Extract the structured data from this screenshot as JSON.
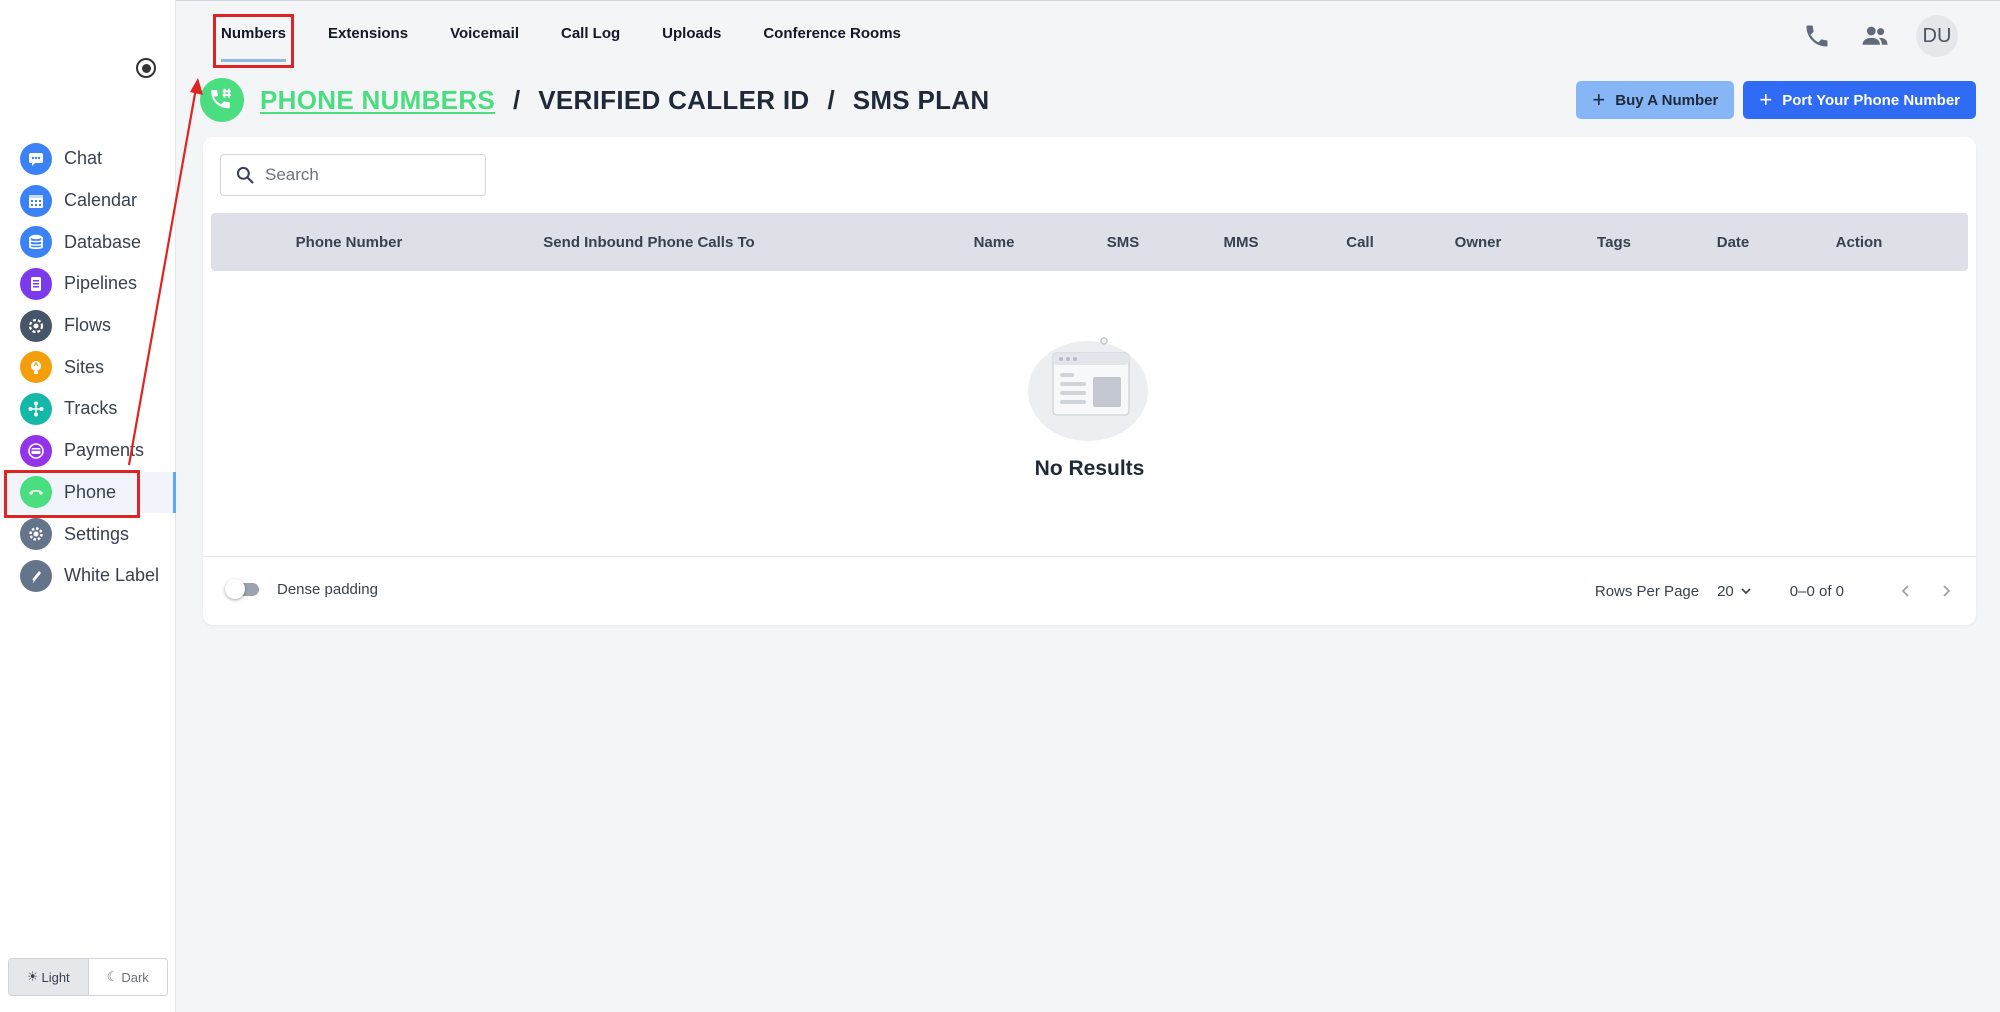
{
  "sidebar": {
    "items": [
      {
        "label": "Chat",
        "icon": "chat-icon",
        "color": "#3b82f6"
      },
      {
        "label": "Calendar",
        "icon": "calendar-icon",
        "color": "#3b82f6"
      },
      {
        "label": "Database",
        "icon": "database-icon",
        "color": "#3b82f6"
      },
      {
        "label": "Pipelines",
        "icon": "pipelines-icon",
        "color": "#7c3aed"
      },
      {
        "label": "Flows",
        "icon": "flows-icon",
        "color": "#475569"
      },
      {
        "label": "Sites",
        "icon": "sites-icon",
        "color": "#f59e0b"
      },
      {
        "label": "Tracks",
        "icon": "tracks-icon",
        "color": "#14b8a6"
      },
      {
        "label": "Payments",
        "icon": "payments-icon",
        "color": "#9333ea"
      },
      {
        "label": "Phone",
        "icon": "phone-icon",
        "color": "#4ade80"
      },
      {
        "label": "Settings",
        "icon": "settings-icon",
        "color": "#64748b"
      },
      {
        "label": "White Label",
        "icon": "white-label-icon",
        "color": "#64748b"
      }
    ],
    "active": "Phone",
    "theme": {
      "light": "Light",
      "dark": "Dark",
      "selected": "Light"
    }
  },
  "tabs": [
    {
      "label": "Numbers"
    },
    {
      "label": "Extensions"
    },
    {
      "label": "Voicemail"
    },
    {
      "label": "Call Log"
    },
    {
      "label": "Uploads"
    },
    {
      "label": "Conference Rooms"
    }
  ],
  "header": {
    "avatar_initials": "DU",
    "crumbs": {
      "phone_numbers": "PHONE NUMBERS",
      "verified_caller_id": "VERIFIED CALLER ID",
      "sms_plan": "SMS PLAN",
      "separator": "/"
    },
    "buy_number": "Buy A Number",
    "port_number": "Port Your Phone Number"
  },
  "table": {
    "search_placeholder": "Search",
    "columns": [
      "Phone Number",
      "Send Inbound Phone Calls To",
      "Name",
      "SMS",
      "MMS",
      "Call",
      "Owner",
      "Tags",
      "Date",
      "Action"
    ],
    "empty_text": "No Results"
  },
  "footer": {
    "dense_padding": "Dense padding",
    "rows_per_page_label": "Rows Per Page",
    "rows_per_page": "20",
    "range": "0–0 of 0"
  },
  "colors": {
    "accent_green": "#4ade80",
    "primary_blue": "#2f6bf5",
    "light_blue": "#86b6f6",
    "annotation_red": "#e02424"
  }
}
